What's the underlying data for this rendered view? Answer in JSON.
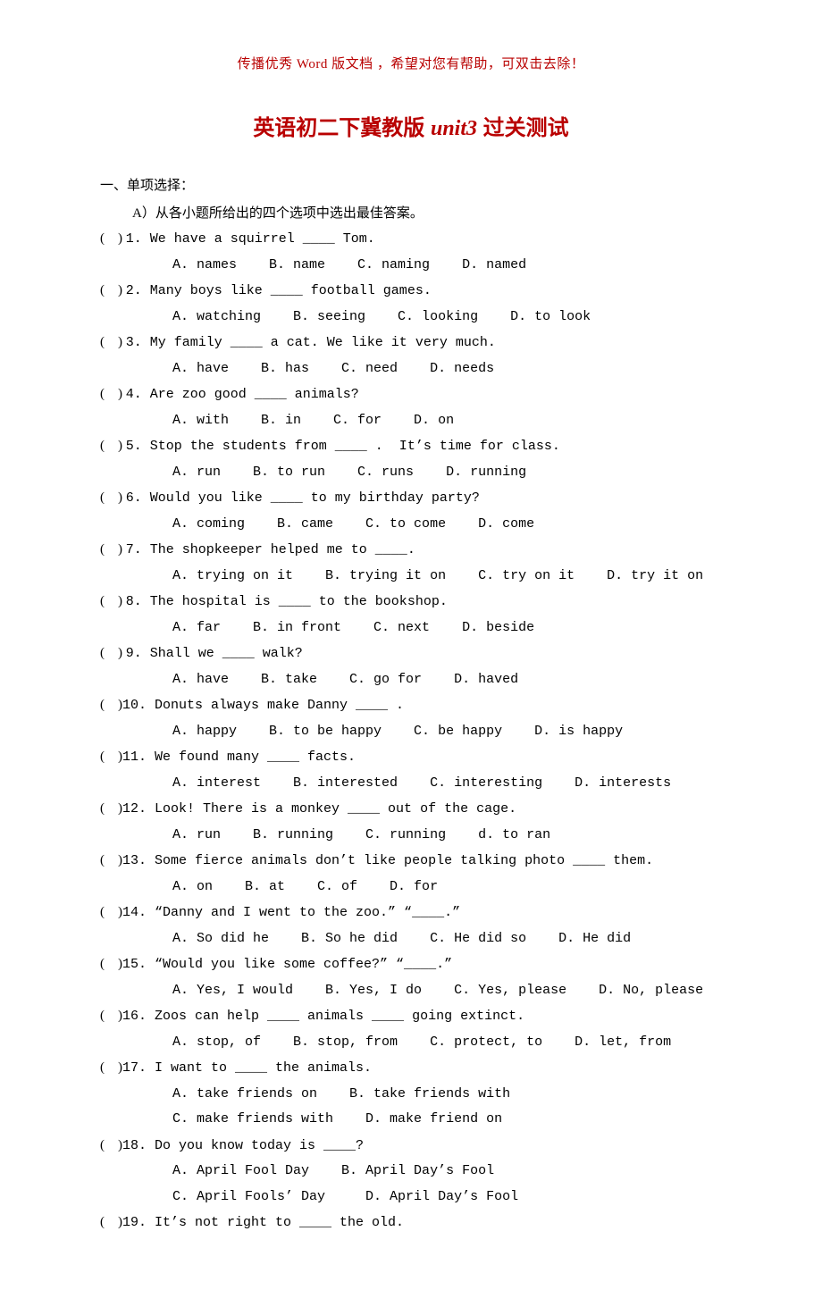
{
  "header_note": "传播优秀 Word 版文档 ，希望对您有帮助，可双击去除！",
  "title_a": "英语初二下冀教版 ",
  "title_unit": "unit3",
  "title_b": " 过关测试",
  "section_label": "一、单项选择：",
  "instruction": "A）从各小题所给出的四个选项中选出最佳答案。",
  "questions": [
    {
      "num": "1",
      "stem": "We have a squirrel ____ Tom.",
      "opts": "A. names    B. name    C. naming    D. named"
    },
    {
      "num": "2",
      "stem": "Many boys like ____ football games.",
      "opts": "A. watching    B. seeing    C. looking    D. to look"
    },
    {
      "num": "3",
      "stem": "My family ____ a cat. We like it very much.",
      "opts": "A. have    B. has    C. need    D. needs"
    },
    {
      "num": "4",
      "stem": "Are zoo good ____ animals?",
      "opts": "A. with    B. in    C. for    D. on"
    },
    {
      "num": "5",
      "stem": "Stop the students from ____ .  It’s time for class.",
      "opts": "A. run    B. to run    C. runs    D. running"
    },
    {
      "num": "6",
      "stem": "Would you like ____ to my birthday party?",
      "opts": "A. coming    B. came    C. to come    D. come"
    },
    {
      "num": "7",
      "stem": "The shopkeeper helped me to ____.",
      "opts": "A. trying on it    B. trying it on    C. try on it    D. try it on"
    },
    {
      "num": "8",
      "stem": "The hospital is ____ to the bookshop.",
      "opts": "A. far    B. in front    C. next    D. beside"
    },
    {
      "num": "9",
      "stem": "Shall we ____ walk?",
      "opts": "A. have    B. take    C. go for    D. haved"
    },
    {
      "num": "10",
      "stem": "Donuts always make Danny ____ .",
      "opts": "A. happy    B. to be happy    C. be happy    D. is happy"
    },
    {
      "num": "11",
      "stem": "We found many ____ facts.",
      "opts": "A. interest    B. interested    C. interesting    D. interests"
    },
    {
      "num": "12",
      "stem": "Look! There is a monkey ____ out of the cage.",
      "opts": "A. run    B. running    C. running    d. to ran"
    },
    {
      "num": "13",
      "stem": "Some fierce animals don’t like people talking photo ____ them.",
      "opts": "A. on    B. at    C. of    D. for"
    },
    {
      "num": "14",
      "stem": "“Danny and I went to the zoo.” “____.”",
      "opts": "A. So did he    B. So he did    C. He did so    D. He did"
    },
    {
      "num": "15",
      "stem": "“Would you like some coffee?” “____.”",
      "opts": "A. Yes, I would    B. Yes, I do    C. Yes, please    D. No, please"
    },
    {
      "num": "16",
      "stem": "Zoos can help ____ animals ____ going extinct.",
      "opts": "A. stop, of    B. stop, from    C. protect, to    D. let, from"
    },
    {
      "num": "17",
      "stem": "I want to ____ the animals.",
      "opts": "A. take friends on    B. take friends with",
      "opts2": "C. make friends with    D. make friend on"
    },
    {
      "num": "18",
      "stem": "Do you know today is ____?",
      "opts": "A. April Fool Day    B. April Day’s Fool",
      "opts2": "C. April Fools’ Day     D. April Day’s Fool"
    },
    {
      "num": "19",
      "stem": "It’s not right to ____ the old."
    }
  ]
}
